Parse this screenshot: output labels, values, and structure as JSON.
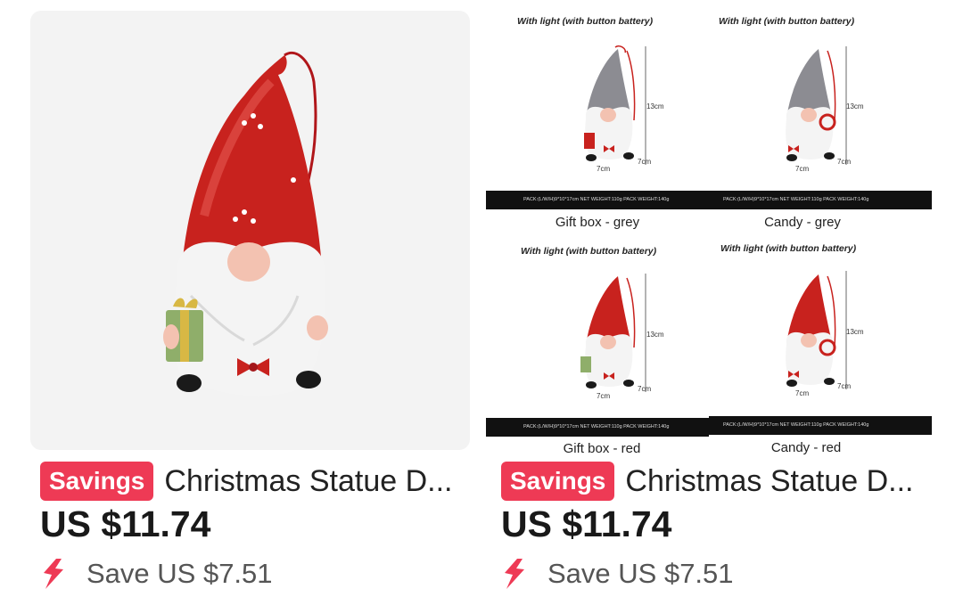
{
  "products": [
    {
      "badge": "Savings",
      "title": "Christmas Statue D...",
      "price": "US $11.74",
      "save": "Save US $7.51"
    },
    {
      "badge": "Savings",
      "title": "Christmas Statue D...",
      "price": "US $11.74",
      "save": "Save US $7.51",
      "variants": [
        {
          "header": "With light (with button battery)",
          "label": "Gift box - grey",
          "height": "13cm",
          "width": "7cm",
          "depth": "7cm",
          "pack": "PACK:(L/W/H)9*10*17cm    NET WEIGHT:110g    PACK WEIGHT:140g"
        },
        {
          "header": "With light (with button battery)",
          "label": "Candy - grey",
          "height": "13cm",
          "width": "7cm",
          "depth": "7cm",
          "pack": "PACK:(L/W/H)9*10*17cm    NET WEIGHT:110g    PACK WEIGHT:140g"
        },
        {
          "header": "With light (with button battery)",
          "label": "Gift box - red",
          "height": "13cm",
          "width": "7cm",
          "depth": "7cm",
          "pack": "PACK:(L/W/H)9*10*17cm    NET WEIGHT:110g    PACK WEIGHT:140g"
        },
        {
          "header": "With light (with button battery)",
          "label": "Candy - red",
          "height": "13cm",
          "width": "7cm",
          "depth": "7cm",
          "pack": "PACK:(L/W/H)9*10*17cm    NET WEIGHT:110g    PACK WEIGHT:140g"
        }
      ]
    }
  ],
  "colors": {
    "badge": "#ee3a55",
    "hat_red": "#c8221e",
    "hat_grey": "#8c8c92",
    "beard": "#f4f4f4"
  },
  "icons": {
    "save": "flame-bolt-icon"
  }
}
